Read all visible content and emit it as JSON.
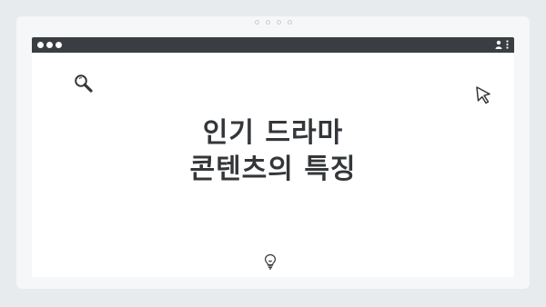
{
  "window": {
    "controls": [
      "close",
      "minimize",
      "maximize"
    ],
    "menu_icons": [
      "user-icon",
      "kebab-menu-icon"
    ]
  },
  "page": {
    "title_line1": "인기 드라마",
    "title_line2": "콘텐츠의 특징"
  },
  "icons": {
    "search": "search-icon",
    "cursor": "cursor-icon",
    "idea": "lightbulb-icon"
  },
  "colors": {
    "background": "#e7ebee",
    "titlebar": "#3a3e42",
    "heading": "#33373a"
  }
}
